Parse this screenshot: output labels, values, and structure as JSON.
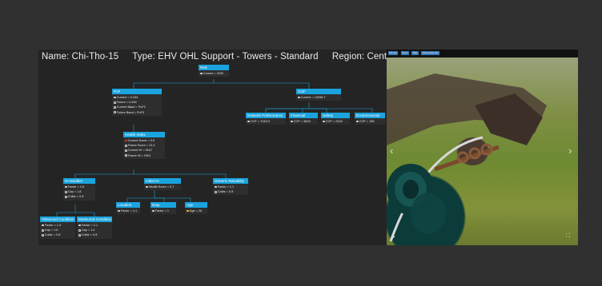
{
  "header": {
    "name": "Name: Chi-Tho-15",
    "type": "Type: EHV OHL Support - Towers - Standard",
    "region": "Region: Central"
  },
  "tree": {
    "risk": {
      "label": "Risk",
      "rows": [
        "Current = 3232"
      ]
    },
    "pof": {
      "label": "PoF",
      "rows": [
        "Current = 0.244",
        "Future = 0.446",
        "Current Band = PoF2",
        "Future Band = PoF3"
      ]
    },
    "cof": {
      "label": "COF",
      "rows": [
        "Current = 13256.7"
      ]
    },
    "network": {
      "label": "Network Performance",
      "rows": [
        "COF = 7249.9"
      ]
    },
    "financial": {
      "label": "Financial",
      "rows": [
        "COF = 3618"
      ]
    },
    "safety": {
      "label": "Safety",
      "rows": [
        "COF = 2318"
      ]
    },
    "environmental": {
      "label": "Environmental",
      "rows": [
        "COF = 155"
      ]
    },
    "health": {
      "label": "Health Index",
      "rows": [
        "Current Score = 9.9",
        "Future Score = 12.4",
        "Current HI = HI10",
        "Future HI = HI10"
      ]
    },
    "himod": {
      "label": "HI Modifier",
      "rows": [
        "Factor = 1.6",
        "Cap = 1.8",
        "Collar = 0.8"
      ]
    },
    "initial": {
      "label": "Initial HI",
      "rows": [
        "Health Score = 9.7"
      ]
    },
    "generic": {
      "label": "Generic Reliability",
      "rows": [
        "Factor = 1.1",
        "Collar = 0.8"
      ]
    },
    "location": {
      "label": "Location",
      "rows": [
        "Factor = 1.1"
      ]
    },
    "duty": {
      "label": "Duty",
      "rows": [
        "Factor = 1"
      ]
    },
    "age": {
      "label": "Age",
      "rows": [
        "Age = 26"
      ]
    },
    "observed": {
      "label": "Observed Condition",
      "rows": [
        "Factor = 1.4",
        "Cap = 1.6",
        "Collar = 0.8"
      ]
    },
    "measured": {
      "label": "Measured Condition",
      "rows": [
        "Factor = 1.1",
        "Cap = 1.4",
        "Collar = 0.8"
      ]
    }
  },
  "photo": {
    "toolbar": [
      "Photos",
      "Docs",
      "Map",
      "View asset info"
    ],
    "prev_icon": "‹",
    "next_icon": "›",
    "play_icon": "▶",
    "fullscreen_icon": "⛶"
  },
  "colors": {
    "node_header": "#1aa3dd",
    "panel": "#242424",
    "page": "#303030"
  }
}
